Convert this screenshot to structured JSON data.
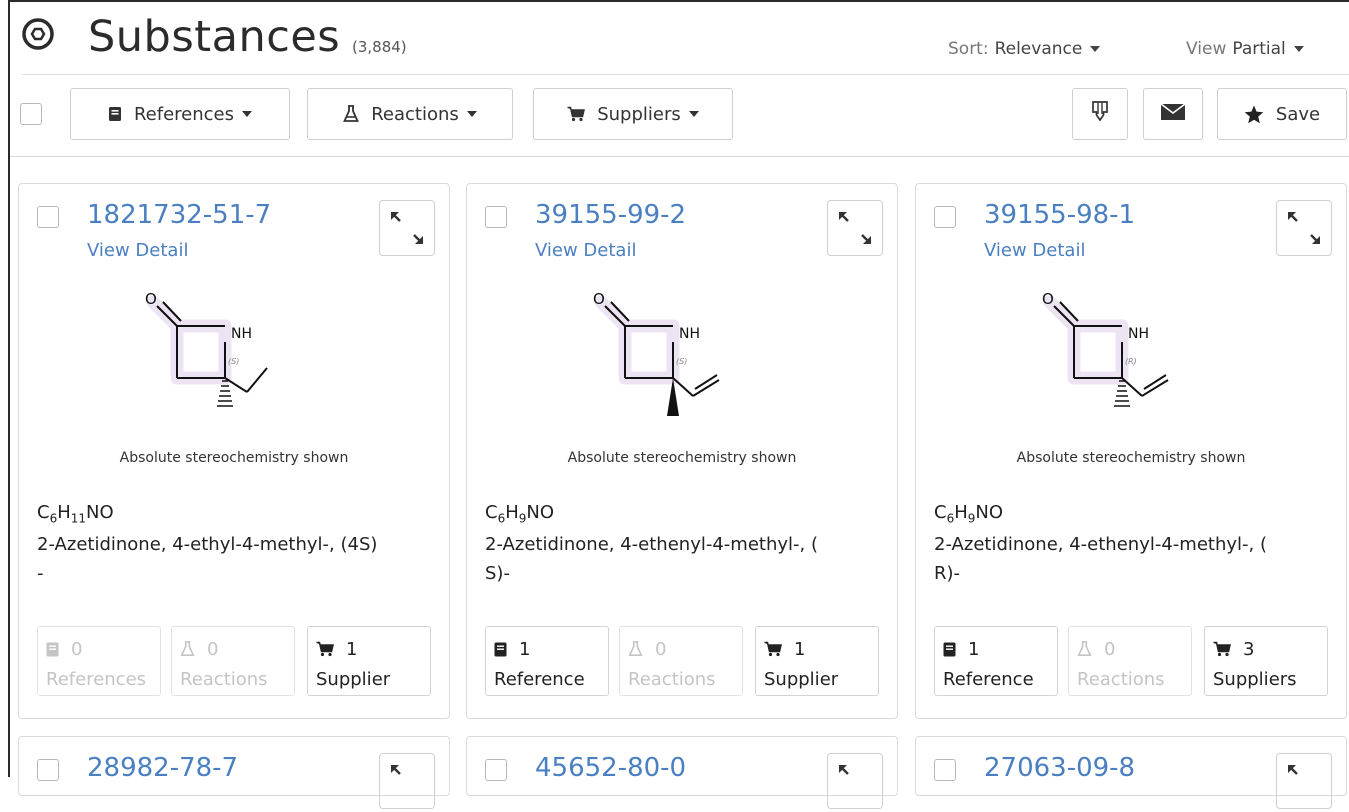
{
  "header": {
    "title": "Substances",
    "count": "(3,884)",
    "sort_label": "Sort:",
    "sort_value": "Relevance",
    "view_label": "View",
    "view_value": "Partial"
  },
  "toolbar": {
    "references": "References",
    "reactions": "Reactions",
    "suppliers": "Suppliers",
    "save": "Save"
  },
  "cards": [
    {
      "cas": "1821732-51-7",
      "view_detail": "View Detail",
      "stereo_label": "(S)",
      "note": "Absolute stereochemistry shown",
      "formula": {
        "c": "C",
        "c_n": "6",
        "h": "H",
        "h_n": "11",
        "rest": "NO"
      },
      "name_line1": "2-Azetidinone, 4-ethyl-4-methyl-, (4S)",
      "name_line2": "-",
      "refs": {
        "count": "0",
        "label": "References"
      },
      "rxns": {
        "count": "0",
        "label": "Reactions"
      },
      "sups": {
        "count": "1",
        "label": "Supplier"
      }
    },
    {
      "cas": "39155-99-2",
      "view_detail": "View Detail",
      "stereo_label": "(S)",
      "note": "Absolute stereochemistry shown",
      "formula": {
        "c": "C",
        "c_n": "6",
        "h": "H",
        "h_n": "9",
        "rest": "NO"
      },
      "name_line1": "2-Azetidinone, 4-ethenyl-4-methyl-, (",
      "name_line2": "S)-",
      "refs": {
        "count": "1",
        "label": "Reference"
      },
      "rxns": {
        "count": "0",
        "label": "Reactions"
      },
      "sups": {
        "count": "1",
        "label": "Supplier"
      }
    },
    {
      "cas": "39155-98-1",
      "view_detail": "View Detail",
      "stereo_label": "(R)",
      "note": "Absolute stereochemistry shown",
      "formula": {
        "c": "C",
        "c_n": "6",
        "h": "H",
        "h_n": "9",
        "rest": "NO"
      },
      "name_line1": "2-Azetidinone, 4-ethenyl-4-methyl-, (",
      "name_line2": "R)-",
      "refs": {
        "count": "1",
        "label": "Reference"
      },
      "rxns": {
        "count": "0",
        "label": "Reactions"
      },
      "sups": {
        "count": "3",
        "label": "Suppliers"
      }
    },
    {
      "cas": "28982-78-7"
    },
    {
      "cas": "45652-80-0"
    },
    {
      "cas": "27063-09-8"
    }
  ],
  "atoms": {
    "oxygen": "O",
    "nh": "NH"
  },
  "colors": {
    "link": "#4a7fc1",
    "highlight": "#ece4f2",
    "disabled": "#c4c4c4"
  }
}
